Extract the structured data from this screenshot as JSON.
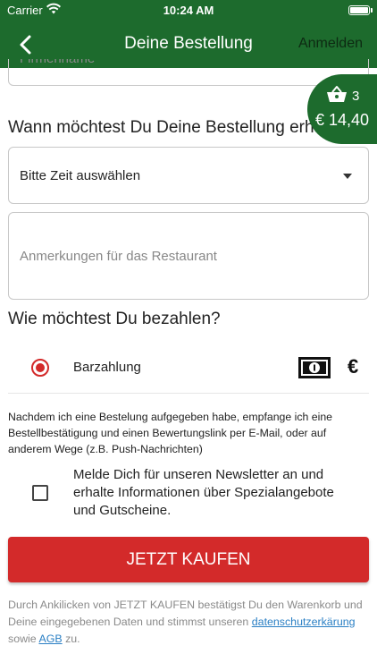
{
  "status": {
    "carrier": "Carrier",
    "time": "10:24 AM"
  },
  "nav": {
    "title": "Deine Bestellung",
    "login": "Anmelden"
  },
  "form": {
    "company_placeholder": "Firmenname",
    "when_heading": "Wann möchtest Du Deine Bestellung erhalten?",
    "time_select_value": "Bitte Zeit auswählen",
    "notes_placeholder": "Anmerkungen für das Restaurant"
  },
  "cart": {
    "count": "3",
    "total": "€ 14,40"
  },
  "payment": {
    "heading": "Wie möchtest Du bezahlen?",
    "options": [
      {
        "label": "Barzahlung",
        "selected": true,
        "icons": [
          "cash-icon",
          "euro-icon"
        ]
      }
    ],
    "euro_symbol": "€"
  },
  "confirmation_info": "Nachdem ich eine Bestelung aufgegeben habe, empfange ich eine Bestellbestätigung und einen Bewertungslink per E-Mail, oder auf anderem Wege (z.B. Push-Nachrichten)",
  "newsletter": {
    "label": "Melde Dich für unseren Newsletter an und erhalte Informationen über Spezialangebote und Gutscheine.",
    "checked": false
  },
  "buy_button": "JETZT KAUFEN",
  "legal": {
    "text_before": "Durch Ankilicken von JETZT KAUFEN bestätigst Du den Warenkorb und Deine eingegebenen Daten und stimmst unseren",
    "privacy_link": "datenschutzerkärung",
    "text_between": "sowie",
    "agb_link": "AGB",
    "text_after": "zu."
  },
  "colors": {
    "brand_green": "#1d6b2d",
    "accent_red": "#d32a2a",
    "link_blue": "#2a7fc4"
  }
}
